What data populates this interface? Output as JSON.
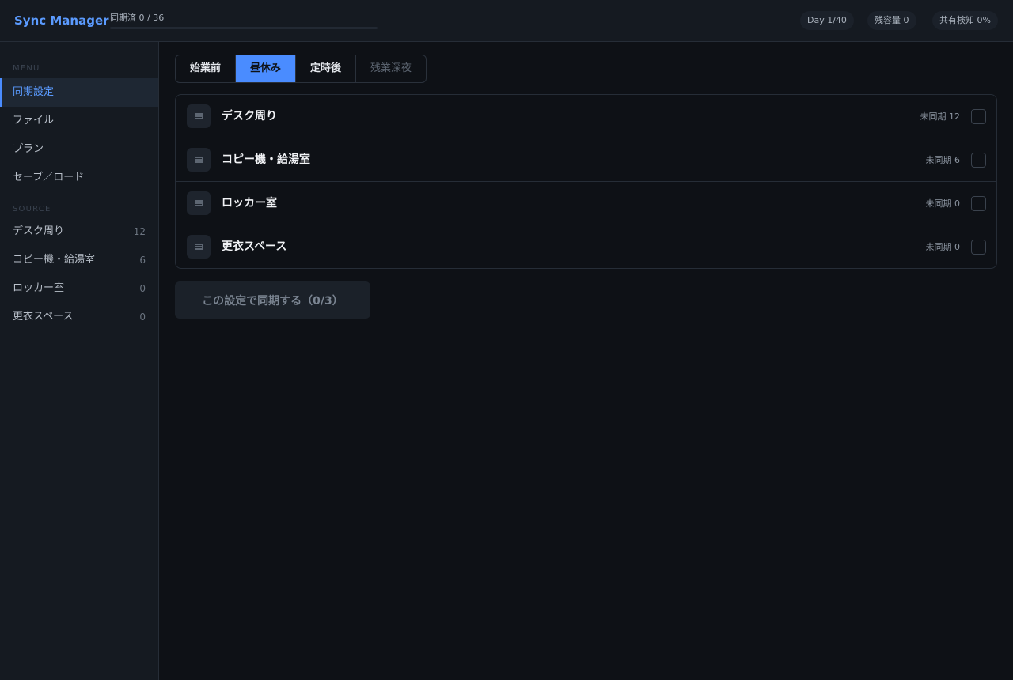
{
  "header": {
    "brand": "Sync Manager",
    "sync_label": "同期済 0 / 36",
    "sync_progress": 0,
    "day": "Day 1/40",
    "capacity": "残容量 0",
    "detect": "共有検知 0%"
  },
  "sidebar": {
    "menu_heading": "MENU",
    "menu_items": [
      {
        "label": "同期設定",
        "active": true
      },
      {
        "label": "ファイル"
      },
      {
        "label": "プラン"
      },
      {
        "label": "セーブ／ロード"
      }
    ],
    "source_heading": "SOURCE",
    "source_items": [
      {
        "label": "デスク周り",
        "count": "12"
      },
      {
        "label": "コピー機・給湯室",
        "count": "6"
      },
      {
        "label": "ロッカー室",
        "count": "0"
      },
      {
        "label": "更衣スペース",
        "count": "0"
      }
    ]
  },
  "tabs": [
    {
      "label": "始業前"
    },
    {
      "label": "昼休み",
      "selected": true
    },
    {
      "label": "定時後"
    },
    {
      "label": "残業深夜",
      "disabled": true
    }
  ],
  "sources": [
    {
      "icon": "folder-icon",
      "name": "デスク周り",
      "pending": "未同期 12"
    },
    {
      "icon": "folder-icon",
      "name": "コピー機・給湯室",
      "pending": "未同期 6"
    },
    {
      "icon": "folder-icon",
      "name": "ロッカー室",
      "pending": "未同期 0"
    },
    {
      "icon": "folder-icon",
      "name": "更衣スペース",
      "pending": "未同期 0"
    }
  ],
  "action": {
    "sync_button": "この設定で同期する（0/3）"
  },
  "colors": {
    "accent": "#4a8cff",
    "background": "#0e1116",
    "panel": "#151a21"
  }
}
